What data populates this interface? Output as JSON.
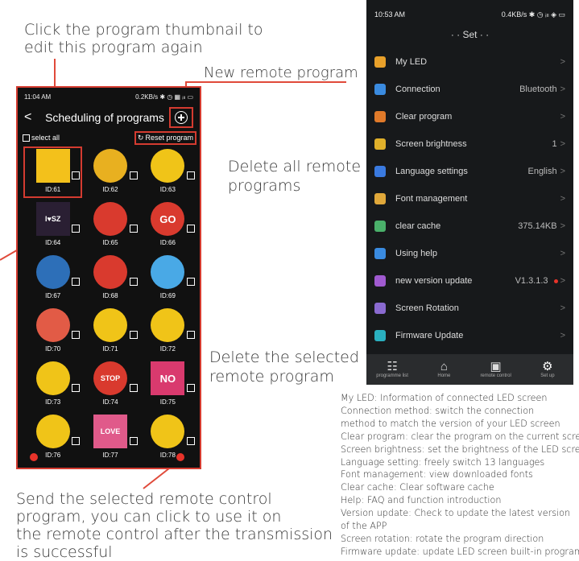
{
  "callouts": {
    "thumbnail": [
      "Click the program thumbnail to",
      "edit this program again"
    ],
    "new_remote": "New remote program",
    "delete_all": [
      "Delete all remote",
      "programs"
    ],
    "delete_selected": [
      "Delete the selected",
      "remote program"
    ],
    "send": [
      "Send the selected remote control",
      "program, you can click to use it on",
      "the remote control after the transmission",
      "is successful"
    ]
  },
  "left_phone": {
    "status_time": "11:04 AM",
    "status_right": "0.2KB/s ✱ ◷ ▦ ᵢₗₗ ▭",
    "back": "<",
    "title": "Scheduling of programs",
    "select_all": "select all",
    "reset_program": "Reset program",
    "programs": [
      {
        "id": "ID:61",
        "icon": "construction-sign-icon",
        "bg": "#f3c11b",
        "selected": true
      },
      {
        "id": "ID:62",
        "icon": "no-sound-icon",
        "bg": "#e8b020"
      },
      {
        "id": "ID:63",
        "icon": "sad-face-icon",
        "bg": "#f0c418"
      },
      {
        "id": "ID:64",
        "icon": "i-love-sz-icon",
        "bg": "#2a1f33"
      },
      {
        "id": "ID:65",
        "icon": "no-phone-icon",
        "bg": "#d93a2e"
      },
      {
        "id": "ID:66",
        "icon": "go-sign-icon",
        "bg": "#d93a2e"
      },
      {
        "id": "ID:67",
        "icon": "pedestrian-icon",
        "bg": "#2d6fb8"
      },
      {
        "id": "ID:68",
        "icon": "no-horn-icon",
        "bg": "#d93a2e"
      },
      {
        "id": "ID:69",
        "icon": "grimace-face-icon",
        "bg": "#49a9e6"
      },
      {
        "id": "ID:70",
        "icon": "crying-face-icon",
        "bg": "#e25b46"
      },
      {
        "id": "ID:71",
        "icon": "cool-face-icon",
        "bg": "#f0c418"
      },
      {
        "id": "ID:72",
        "icon": "tears-face-icon",
        "bg": "#f0c418"
      },
      {
        "id": "ID:73",
        "icon": "dizzy-face-icon",
        "bg": "#f0c418"
      },
      {
        "id": "ID:74",
        "icon": "stop-sign-icon",
        "bg": "#d93a2e"
      },
      {
        "id": "ID:75",
        "icon": "no-sign-icon",
        "bg": "#d93a6e"
      },
      {
        "id": "ID:76",
        "icon": "kiss-face-icon",
        "bg": "#f0c418"
      },
      {
        "id": "ID:77",
        "icon": "love-heart-icon",
        "bg": "#e05a8a"
      },
      {
        "id": "ID:78",
        "icon": "smile-face-icon",
        "bg": "#f0c418"
      }
    ],
    "thumb_text": {
      "i-love-sz-icon": "I♥SZ",
      "go-sign-icon": "GO",
      "stop-sign-icon": "STOP",
      "no-sign-icon": "NO",
      "love-heart-icon": "LOVE"
    }
  },
  "right_phone": {
    "status_time": "10:53 AM",
    "status_right": "0.4KB/s ✱ ◷ ᵢₗₗ ◈ ▭",
    "title": "· · Set · ·",
    "items": [
      {
        "label": "My LED",
        "value": "",
        "icon": "user-icon",
        "color": "#e8a02a"
      },
      {
        "label": "Connection",
        "value": "Bluetooth",
        "icon": "link-icon",
        "color": "#3a8be0"
      },
      {
        "label": "Clear program",
        "value": "",
        "icon": "trash-icon",
        "color": "#e07a2a"
      },
      {
        "label": "Screen brightness",
        "value": "1",
        "icon": "sun-icon",
        "color": "#e0b02a"
      },
      {
        "label": "Language settings",
        "value": "English",
        "icon": "language-icon",
        "color": "#3a7ae0"
      },
      {
        "label": "Font management",
        "value": "",
        "icon": "font-icon",
        "color": "#e0a83a"
      },
      {
        "label": "clear cache",
        "value": "375.14KB",
        "icon": "cache-icon",
        "color": "#4ab06a"
      },
      {
        "label": "Using help",
        "value": "",
        "icon": "help-icon",
        "color": "#3a8be0"
      },
      {
        "label": "new version update",
        "value": "V1.3.1.3",
        "icon": "info-icon",
        "color": "#a05ad0",
        "dot": true
      },
      {
        "label": "Screen Rotation",
        "value": "",
        "icon": "rotate-icon",
        "color": "#8a6ad0"
      },
      {
        "label": "Firmware Update",
        "value": "",
        "icon": "firmware-icon",
        "color": "#2ab0c0"
      }
    ],
    "chevron": ">",
    "tabs": [
      {
        "label": "programme list",
        "icon": "list-icon",
        "glyph": "☷"
      },
      {
        "label": "Home",
        "icon": "home-icon",
        "glyph": "⌂"
      },
      {
        "label": "remote control",
        "icon": "remote-icon",
        "glyph": "▣"
      },
      {
        "label": "Set up",
        "icon": "gear-icon",
        "glyph": "⚙"
      }
    ]
  },
  "description": [
    "My LED: Information of connected LED screen",
    "Connection method: switch the connection",
    "method to match the version of your LED screen",
    "Clear program: clear the program on the current screen",
    "Screen brightness: set the brightness of the LED screen",
    "Language setting: freely switch 13 languages",
    "Font management: view downloaded fonts",
    "Clear cache: Clear software cache",
    "Help: FAQ and function introduction",
    "Version update: Check to update the latest version",
    " of the APP",
    "Screen rotation: rotate the program direction",
    "Firmware update: update LED screen built-in program"
  ]
}
